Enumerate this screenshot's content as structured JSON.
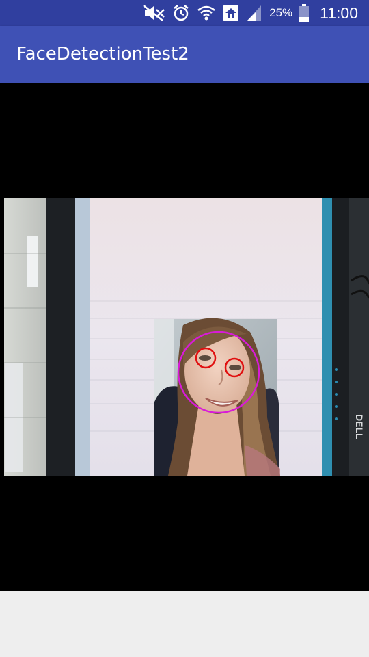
{
  "status_bar": {
    "battery_percent": "25%",
    "time": "11:00",
    "icons": [
      "mute-icon",
      "alarm-icon",
      "wifi-icon",
      "home-network-icon",
      "signal-icon",
      "battery-icon"
    ]
  },
  "app_bar": {
    "title": "FaceDetectionTest2",
    "color": "#3f51b5"
  },
  "detection": {
    "face_circle_color": "#d81bd8",
    "eye_circle_color": "#e01010",
    "monitor_brand": "DELL"
  }
}
